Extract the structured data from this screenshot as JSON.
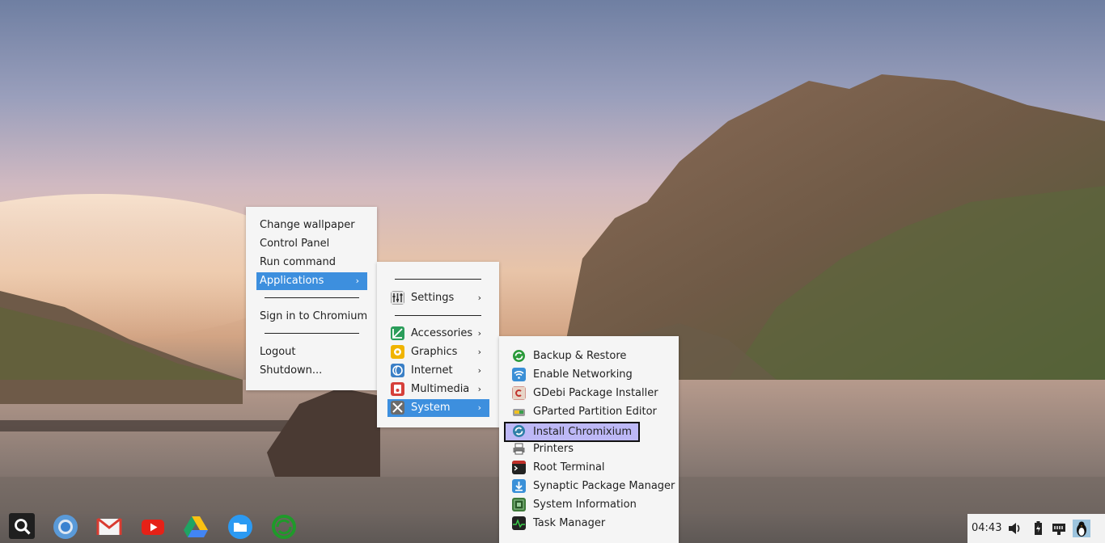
{
  "desktop_menu": {
    "items": [
      {
        "label": "Change wallpaper"
      },
      {
        "label": "Control Panel"
      },
      {
        "label": "Run command"
      },
      {
        "label": "Applications",
        "arrow": "›"
      },
      {
        "label": "Sign in to Chromium"
      },
      {
        "label": "Logout"
      },
      {
        "label": "Shutdown..."
      }
    ]
  },
  "applications_menu": {
    "items": [
      {
        "label": "Settings",
        "arrow": "›",
        "icon": "settings-icon"
      },
      {
        "label": "Accessories",
        "arrow": "›",
        "icon": "accessories-icon"
      },
      {
        "label": "Graphics",
        "arrow": "›",
        "icon": "graphics-icon"
      },
      {
        "label": "Internet",
        "arrow": "›",
        "icon": "internet-icon"
      },
      {
        "label": "Multimedia",
        "arrow": "›",
        "icon": "multimedia-icon"
      },
      {
        "label": "System",
        "arrow": "›",
        "icon": "system-icon"
      }
    ]
  },
  "system_menu": {
    "items": [
      {
        "label": "Backup & Restore",
        "icon": "backup-restore-icon"
      },
      {
        "label": "Enable Networking",
        "icon": "wifi-icon"
      },
      {
        "label": "GDebi Package Installer",
        "icon": "gdebi-icon"
      },
      {
        "label": "GParted Partition Editor",
        "icon": "gparted-icon"
      },
      {
        "label": "Install Chromixium",
        "icon": "install-chromixium-icon"
      },
      {
        "label": "Printers",
        "icon": "printer-icon"
      },
      {
        "label": "Root Terminal",
        "icon": "terminal-icon"
      },
      {
        "label": "Synaptic Package Manager",
        "icon": "synaptic-icon"
      },
      {
        "label": "System Information",
        "icon": "system-info-icon"
      },
      {
        "label": "Task Manager",
        "icon": "task-manager-icon"
      }
    ]
  },
  "taskbar": {
    "launchers": [
      "search-icon",
      "chromium-icon",
      "gmail-icon",
      "youtube-icon",
      "google-drive-icon",
      "files-icon",
      "backup-sync-icon"
    ]
  },
  "tray": {
    "time": "04:43",
    "icons": [
      "volume-icon",
      "battery-icon",
      "network-icon",
      "user-avatar-icon"
    ]
  },
  "colors": {
    "menu_bg": "#f5f5f5",
    "active": "#3d8fde",
    "highlight": "#bdb8f6"
  }
}
